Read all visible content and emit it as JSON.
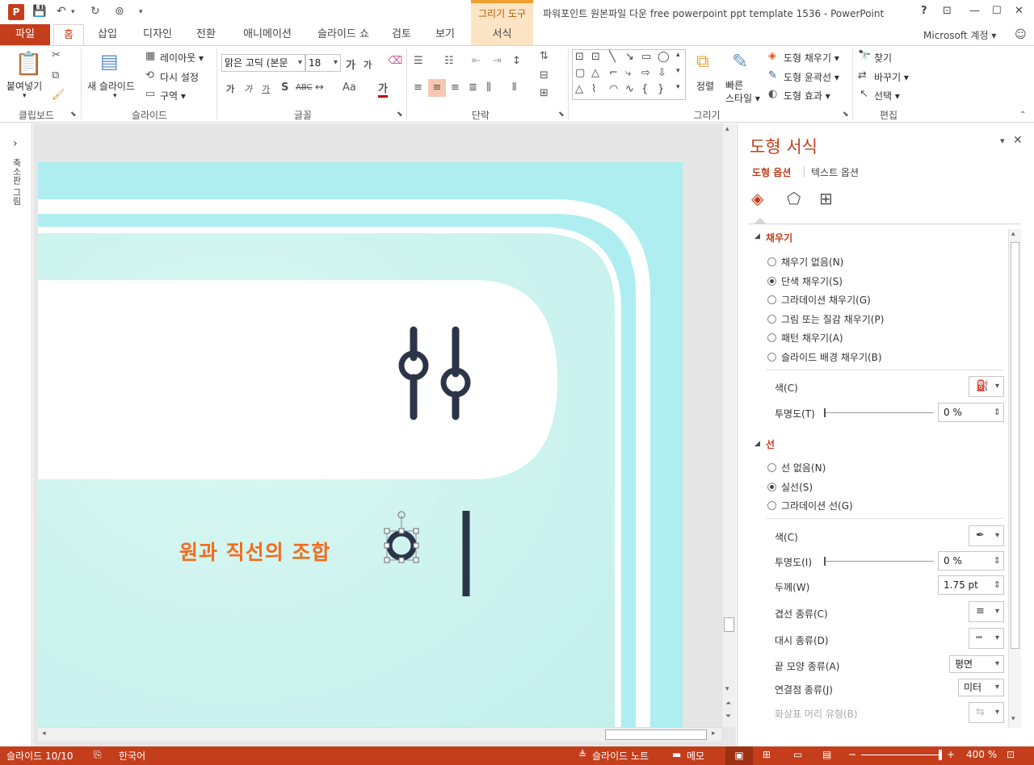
{
  "titlebar": {
    "app_badge": "P",
    "context_tab": "그리기 도구",
    "document_title": "파워포인트 원본파일 다운 free powerpoint ppt template 1536 - PowerPoint",
    "help": "?",
    "minimize": "—",
    "maximize": "☐",
    "close": "✕"
  },
  "tabs": {
    "file": "파일",
    "home": "홈",
    "insert": "삽입",
    "design": "디자인",
    "transitions": "전환",
    "animations": "애니메이션",
    "slideshow": "슬라이드 쇼",
    "review": "검토",
    "view": "보기",
    "format": "서식",
    "account": "Microsoft 계정 ▾"
  },
  "ribbon": {
    "clipboard": {
      "paste": "붙여넣기",
      "label": "클립보드"
    },
    "slides": {
      "new_slide": "새 슬라이드",
      "layout": "레이아웃 ▾",
      "reset": "다시 설정",
      "section": "구역 ▾",
      "label": "슬라이드"
    },
    "font": {
      "font_name": "맑은 고딕 (본문",
      "font_size": "18",
      "label": "글꼴"
    },
    "paragraph": {
      "label": "단락"
    },
    "drawing": {
      "arrange": "정렬",
      "quick_styles": "빠른\n스타일 ▾",
      "shape_fill": "도형 채우기 ▾",
      "shape_outline": "도형 윤곽선 ▾",
      "shape_effects": "도형 효과 ▾",
      "label": "그리기"
    },
    "editing": {
      "find": "찾기",
      "replace": "바꾸기 ▾",
      "select": "선택 ▾",
      "label": "편집"
    }
  },
  "thumb_pane": {
    "label": "축소판 그림",
    "expand": "›"
  },
  "slide": {
    "caption": "원과 직선의 조합"
  },
  "format_pane": {
    "title": "도형 서식",
    "tab_shape": "도형 옵션",
    "tab_text": "텍스트 옵션",
    "fill": {
      "header": "채우기",
      "options": [
        "채우기 없음(N)",
        "단색 채우기(S)",
        "그라데이션 채우기(G)",
        "그림 또는 질감 채우기(P)",
        "패턴 채우기(A)",
        "슬라이드 배경 채우기(B)"
      ],
      "selected_index": 1,
      "color_label": "색(C)",
      "transparency_label": "투명도(T)",
      "transparency_value": "0 %"
    },
    "line": {
      "header": "선",
      "options": [
        "선 없음(N)",
        "실선(S)",
        "그라데이션 선(G)"
      ],
      "selected_index": 1,
      "color_label": "색(C)",
      "transparency_label": "투명도(I)",
      "transparency_value": "0 %",
      "width_label": "두께(W)",
      "width_value": "1.75 pt",
      "compound_label": "겹선 종류(C)",
      "dash_label": "대시 종류(D)",
      "cap_label": "끝 모양 종류(A)",
      "cap_value": "평면",
      "join_label": "연결점 종류(J)",
      "join_value": "미터",
      "arrow_label": "화살표 머리 유형(B)"
    }
  },
  "statusbar": {
    "slide_count": "슬라이드 10/10",
    "language": "한국어",
    "notes": "슬라이드 노트",
    "comments": "메모",
    "zoom": "400 %"
  },
  "colors": {
    "accent": "#c43e1c",
    "slide_cyan": "#aeeef0",
    "slide_mint": "#cdf4ef",
    "icon_navy": "#2b3547",
    "caption_orange": "#f36b1c"
  }
}
